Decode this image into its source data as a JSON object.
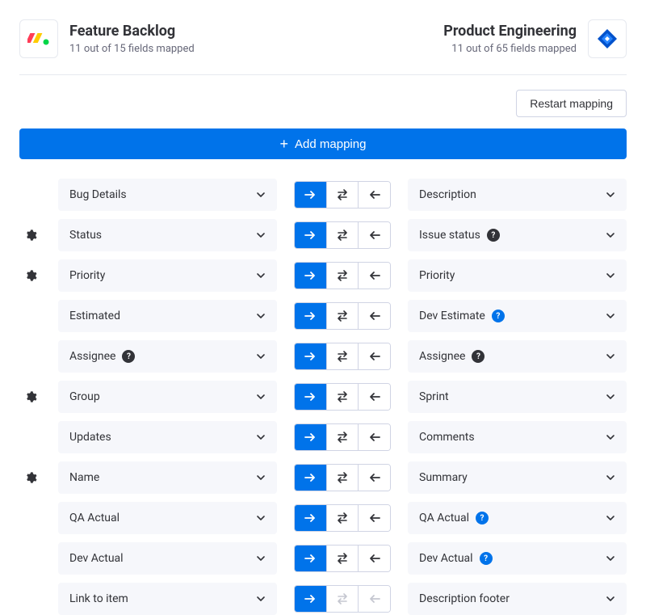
{
  "header": {
    "left": {
      "title": "Feature Backlog",
      "subtitle": "11 out of 15 fields mapped"
    },
    "right": {
      "title": "Product Engineering",
      "subtitle": "11 out of 65 fields mapped"
    }
  },
  "actions": {
    "restart_label": "Restart mapping",
    "add_mapping_label": "Add mapping"
  },
  "rows": [
    {
      "gear": false,
      "left": "Bug Details",
      "left_badge": null,
      "right": "Description",
      "right_badge": null,
      "disable_rest": false
    },
    {
      "gear": true,
      "left": "Status",
      "left_badge": null,
      "right": "Issue status",
      "right_badge": "dark",
      "disable_rest": false
    },
    {
      "gear": true,
      "left": "Priority",
      "left_badge": null,
      "right": "Priority",
      "right_badge": null,
      "disable_rest": false
    },
    {
      "gear": false,
      "left": "Estimated",
      "left_badge": null,
      "right": "Dev Estimate",
      "right_badge": "blue",
      "disable_rest": false
    },
    {
      "gear": false,
      "left": "Assignee",
      "left_badge": "dark",
      "right": "Assignee",
      "right_badge": "dark",
      "disable_rest": false
    },
    {
      "gear": true,
      "left": "Group",
      "left_badge": null,
      "right": "Sprint",
      "right_badge": null,
      "disable_rest": false
    },
    {
      "gear": false,
      "left": "Updates",
      "left_badge": null,
      "right": "Comments",
      "right_badge": null,
      "disable_rest": false
    },
    {
      "gear": true,
      "left": "Name",
      "left_badge": null,
      "right": "Summary",
      "right_badge": null,
      "disable_rest": false
    },
    {
      "gear": false,
      "left": "QA Actual",
      "left_badge": null,
      "right": "QA Actual",
      "right_badge": "blue",
      "disable_rest": false
    },
    {
      "gear": false,
      "left": "Dev Actual",
      "left_badge": null,
      "right": "Dev Actual",
      "right_badge": "blue",
      "disable_rest": false
    },
    {
      "gear": false,
      "left": "Link to item",
      "left_badge": null,
      "right": "Description footer",
      "right_badge": null,
      "disable_rest": true
    }
  ]
}
